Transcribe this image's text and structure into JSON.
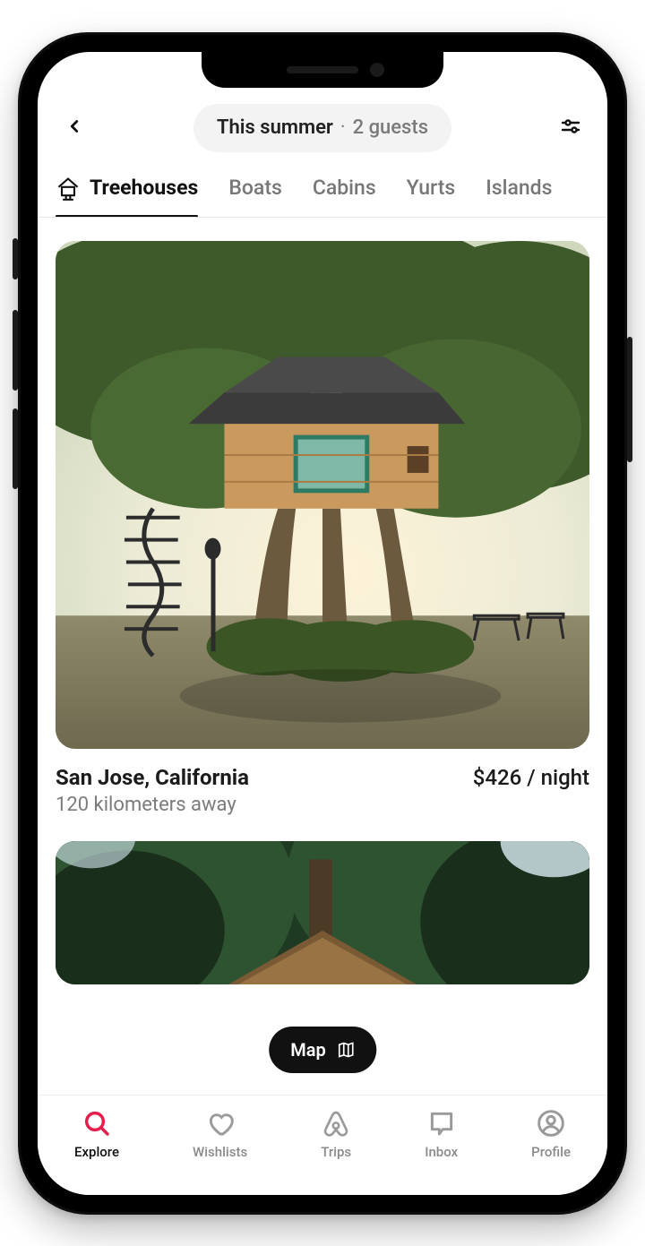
{
  "header": {
    "when": "This summer",
    "guests": "2 guests"
  },
  "categories": [
    {
      "label": "Treehouses",
      "active": true
    },
    {
      "label": "Boats",
      "active": false
    },
    {
      "label": "Cabins",
      "active": false
    },
    {
      "label": "Yurts",
      "active": false
    },
    {
      "label": "Islands",
      "active": false
    }
  ],
  "listings": [
    {
      "location": "San Jose, California",
      "distance": "120 kilometers away",
      "price": "$426 / night"
    }
  ],
  "mapButton": {
    "label": "Map"
  },
  "nav": {
    "explore": "Explore",
    "wishlists": "Wishlists",
    "trips": "Trips",
    "inbox": "Inbox",
    "profile": "Profile"
  },
  "colors": {
    "accent": "#e61e4d",
    "text": "#111",
    "muted": "#7a7a7a"
  }
}
